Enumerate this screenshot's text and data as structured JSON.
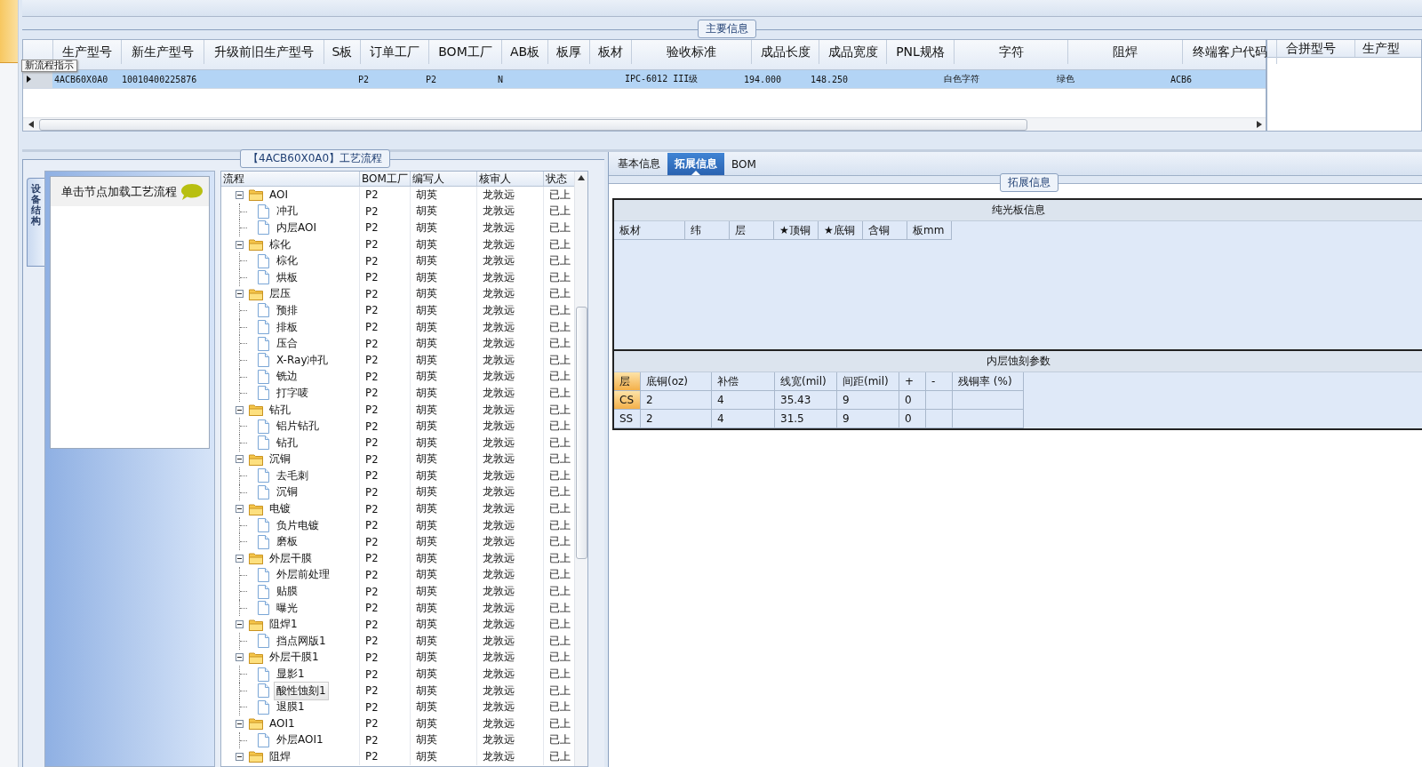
{
  "main_info": {
    "legend": "主要信息",
    "tooltip": "新流程指示",
    "columns": [
      {
        "header": "生产型号",
        "value": "4ACB60X0A0"
      },
      {
        "header": "新生产型号",
        "value": "10010400225876"
      },
      {
        "header": "升级前旧生产型号"
      },
      {
        "header": "S板"
      },
      {
        "header": "订单工厂",
        "value": "P2"
      },
      {
        "header": "BOM工厂",
        "value": "P2"
      },
      {
        "header": "AB板",
        "value": "N"
      },
      {
        "header": "板厚"
      },
      {
        "header": "板材"
      },
      {
        "header": "验收标准",
        "value": "IPC-6012 III级"
      },
      {
        "header": "成品长度",
        "value": "194.000"
      },
      {
        "header": "成品宽度",
        "value": "148.250"
      },
      {
        "header": "PNL规格"
      },
      {
        "header": "字符",
        "value": "白色字符"
      },
      {
        "header": "阻焊",
        "value": "绿色"
      },
      {
        "header": "终端客户代码",
        "value": "ACB6"
      }
    ],
    "row_selected": true,
    "side_columns": [
      "合拼型号",
      "生产型"
    ]
  },
  "process": {
    "legend": "【4ACB60X0A0】工艺流程",
    "side_tab": "设备结构",
    "hint": "单击节点加载工艺流程",
    "columns": [
      "流程",
      "BOM工厂",
      "编写人",
      "核审人",
      "状态"
    ],
    "tree": [
      {
        "kind": "folder",
        "name": "AOI",
        "bom": "P2",
        "writer": "胡英",
        "reviewer": "龙敦远",
        "status": "已上",
        "expanded": true,
        "selected": false,
        "children": [
          {
            "kind": "file",
            "name": "冲孔",
            "bom": "P2",
            "writer": "胡英",
            "reviewer": "龙敦远",
            "status": "已上",
            "selected": false
          },
          {
            "kind": "file",
            "name": "内层AOI",
            "bom": "P2",
            "writer": "胡英",
            "reviewer": "龙敦远",
            "status": "已上",
            "selected": false
          }
        ]
      },
      {
        "kind": "folder",
        "name": "棕化",
        "bom": "P2",
        "writer": "胡英",
        "reviewer": "龙敦远",
        "status": "已上",
        "expanded": true,
        "selected": false,
        "children": [
          {
            "kind": "file",
            "name": "棕化",
            "bom": "P2",
            "writer": "胡英",
            "reviewer": "龙敦远",
            "status": "已上",
            "selected": false
          },
          {
            "kind": "file",
            "name": "烘板",
            "bom": "P2",
            "writer": "胡英",
            "reviewer": "龙敦远",
            "status": "已上",
            "selected": false
          }
        ]
      },
      {
        "kind": "folder",
        "name": "层压",
        "bom": "P2",
        "writer": "胡英",
        "reviewer": "龙敦远",
        "status": "已上",
        "expanded": true,
        "selected": false,
        "children": [
          {
            "kind": "file",
            "name": "预排",
            "bom": "P2",
            "writer": "胡英",
            "reviewer": "龙敦远",
            "status": "已上",
            "selected": false
          },
          {
            "kind": "file",
            "name": "排板",
            "bom": "P2",
            "writer": "胡英",
            "reviewer": "龙敦远",
            "status": "已上",
            "selected": false
          },
          {
            "kind": "file",
            "name": "压合",
            "bom": "P2",
            "writer": "胡英",
            "reviewer": "龙敦远",
            "status": "已上",
            "selected": false
          },
          {
            "kind": "file",
            "name": "X-Ray冲孔",
            "bom": "P2",
            "writer": "胡英",
            "reviewer": "龙敦远",
            "status": "已上",
            "selected": false
          },
          {
            "kind": "file",
            "name": "铣边",
            "bom": "P2",
            "writer": "胡英",
            "reviewer": "龙敦远",
            "status": "已上",
            "selected": false
          },
          {
            "kind": "file",
            "name": "打字唛",
            "bom": "P2",
            "writer": "胡英",
            "reviewer": "龙敦远",
            "status": "已上",
            "selected": false
          }
        ]
      },
      {
        "kind": "folder",
        "name": "钻孔",
        "bom": "P2",
        "writer": "胡英",
        "reviewer": "龙敦远",
        "status": "已上",
        "expanded": true,
        "selected": false,
        "children": [
          {
            "kind": "file",
            "name": "铝片钻孔",
            "bom": "P2",
            "writer": "胡英",
            "reviewer": "龙敦远",
            "status": "已上",
            "selected": false
          },
          {
            "kind": "file",
            "name": "钻孔",
            "bom": "P2",
            "writer": "胡英",
            "reviewer": "龙敦远",
            "status": "已上",
            "selected": false
          }
        ]
      },
      {
        "kind": "folder",
        "name": "沉铜",
        "bom": "P2",
        "writer": "胡英",
        "reviewer": "龙敦远",
        "status": "已上",
        "expanded": true,
        "selected": false,
        "children": [
          {
            "kind": "file",
            "name": "去毛刺",
            "bom": "P2",
            "writer": "胡英",
            "reviewer": "龙敦远",
            "status": "已上",
            "selected": false
          },
          {
            "kind": "file",
            "name": "沉铜",
            "bom": "P2",
            "writer": "胡英",
            "reviewer": "龙敦远",
            "status": "已上",
            "selected": false
          }
        ]
      },
      {
        "kind": "folder",
        "name": "电镀",
        "bom": "P2",
        "writer": "胡英",
        "reviewer": "龙敦远",
        "status": "已上",
        "expanded": true,
        "selected": false,
        "children": [
          {
            "kind": "file",
            "name": "负片电镀",
            "bom": "P2",
            "writer": "胡英",
            "reviewer": "龙敦远",
            "status": "已上",
            "selected": false
          },
          {
            "kind": "file",
            "name": "磨板",
            "bom": "P2",
            "writer": "胡英",
            "reviewer": "龙敦远",
            "status": "已上",
            "selected": false
          }
        ]
      },
      {
        "kind": "folder",
        "name": "外层干膜",
        "bom": "P2",
        "writer": "胡英",
        "reviewer": "龙敦远",
        "status": "已上",
        "expanded": true,
        "selected": false,
        "children": [
          {
            "kind": "file",
            "name": "外层前处理",
            "bom": "P2",
            "writer": "胡英",
            "reviewer": "龙敦远",
            "status": "已上",
            "selected": false
          },
          {
            "kind": "file",
            "name": "贴膜",
            "bom": "P2",
            "writer": "胡英",
            "reviewer": "龙敦远",
            "status": "已上",
            "selected": false
          },
          {
            "kind": "file",
            "name": "曝光",
            "bom": "P2",
            "writer": "胡英",
            "reviewer": "龙敦远",
            "status": "已上",
            "selected": false
          }
        ]
      },
      {
        "kind": "folder",
        "name": "阻焊1",
        "bom": "P2",
        "writer": "胡英",
        "reviewer": "龙敦远",
        "status": "已上",
        "expanded": true,
        "selected": false,
        "children": [
          {
            "kind": "file",
            "name": "挡点网版1",
            "bom": "P2",
            "writer": "胡英",
            "reviewer": "龙敦远",
            "status": "已上",
            "selected": false
          }
        ]
      },
      {
        "kind": "folder",
        "name": "外层干膜1",
        "bom": "P2",
        "writer": "胡英",
        "reviewer": "龙敦远",
        "status": "已上",
        "expanded": true,
        "selected": false,
        "children": [
          {
            "kind": "file",
            "name": "显影1",
            "bom": "P2",
            "writer": "胡英",
            "reviewer": "龙敦远",
            "status": "已上",
            "selected": false
          },
          {
            "kind": "file",
            "name": "酸性蚀刻1",
            "bom": "P2",
            "writer": "胡英",
            "reviewer": "龙敦远",
            "status": "已上",
            "selected": true
          },
          {
            "kind": "file",
            "name": "退膜1",
            "bom": "P2",
            "writer": "胡英",
            "reviewer": "龙敦远",
            "status": "已上",
            "selected": false
          }
        ]
      },
      {
        "kind": "folder",
        "name": "AOI1",
        "bom": "P2",
        "writer": "胡英",
        "reviewer": "龙敦远",
        "status": "已上",
        "expanded": true,
        "selected": false,
        "children": [
          {
            "kind": "file",
            "name": "外层AOI1",
            "bom": "P2",
            "writer": "胡英",
            "reviewer": "龙敦远",
            "status": "已上",
            "selected": false
          }
        ]
      },
      {
        "kind": "folder",
        "name": "阻焊",
        "bom": "P2",
        "writer": "胡英",
        "reviewer": "龙敦远",
        "status": "已上",
        "expanded": true,
        "selected": false
      }
    ]
  },
  "detail": {
    "tabs": [
      {
        "label": "基本信息",
        "selected": false
      },
      {
        "label": "拓展信息",
        "selected": true
      },
      {
        "label": "BOM",
        "selected": false
      }
    ],
    "legend": "拓展信息",
    "bare_board": {
      "title": "纯光板信息",
      "columns": [
        "板材",
        "纬",
        "层",
        "★顶铜",
        "★底铜",
        "含铜",
        "板mm"
      ]
    },
    "inner_etch": {
      "title": "内层蚀刻参数",
      "columns": [
        "层",
        "底铜(oz)",
        "补偿",
        "线宽(mil)",
        "间距(mil)",
        "+",
        "-",
        "残铜率 (%)"
      ],
      "rows": [
        {
          "layer": "CS",
          "selected": true,
          "values": [
            "2",
            "4",
            "35.43",
            "9",
            "0"
          ]
        },
        {
          "layer": "SS",
          "selected": false,
          "values": [
            "2",
            "4",
            "31.5",
            "9",
            "0"
          ]
        }
      ]
    }
  }
}
